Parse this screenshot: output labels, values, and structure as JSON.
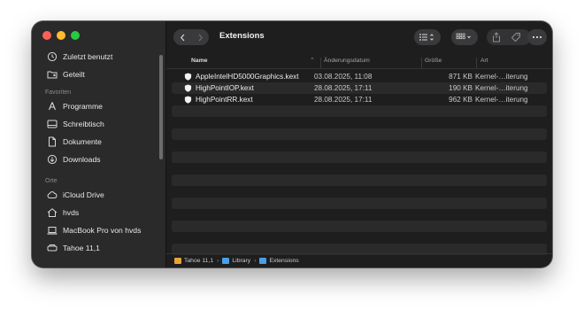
{
  "window": {
    "title": "Extensions"
  },
  "colors": {
    "folder_blue": "#4a9ee8",
    "drive_orange": "#e8a33a"
  },
  "sidebar": {
    "items_top": [
      {
        "label": "Zuletzt benutzt",
        "icon": "clock-icon"
      },
      {
        "label": "Geteilt",
        "icon": "shared-folder-icon"
      }
    ],
    "favorites_heading": "Favoriten",
    "favorites": [
      {
        "label": "Programme",
        "icon": "applications-icon"
      },
      {
        "label": "Schreibtisch",
        "icon": "desktop-icon"
      },
      {
        "label": "Dokumente",
        "icon": "document-icon"
      },
      {
        "label": "Downloads",
        "icon": "download-icon"
      }
    ],
    "locations_heading": "Orte",
    "locations": [
      {
        "label": "iCloud Drive",
        "icon": "cloud-icon"
      },
      {
        "label": "hvds",
        "icon": "home-icon"
      },
      {
        "label": "MacBook Pro von hvds",
        "icon": "laptop-icon"
      },
      {
        "label": "Tahoe 11,1",
        "icon": "drive-icon"
      }
    ]
  },
  "columns": {
    "name": "Name",
    "date": "Änderungsdatum",
    "size": "Größe",
    "kind": "Art"
  },
  "files": [
    {
      "name": "AppleIntelHD5000Graphics.kext",
      "date": "03.08.2025, 11:08",
      "size": "871 KB",
      "kind": "Kernel-…iterung"
    },
    {
      "name": "HighPointIOP.kext",
      "date": "28.08.2025, 17:11",
      "size": "190 KB",
      "kind": "Kernel-…iterung"
    },
    {
      "name": "HighPointRR.kext",
      "date": "28.08.2025, 17:11",
      "size": "962 KB",
      "kind": "Kernel-…iterung"
    }
  ],
  "path": [
    {
      "label": "Tahoe 11,1",
      "icon": "drive-icon"
    },
    {
      "label": "Library",
      "icon": "folder-icon"
    },
    {
      "label": "Extensions",
      "icon": "folder-icon"
    }
  ],
  "path_separator": "›"
}
